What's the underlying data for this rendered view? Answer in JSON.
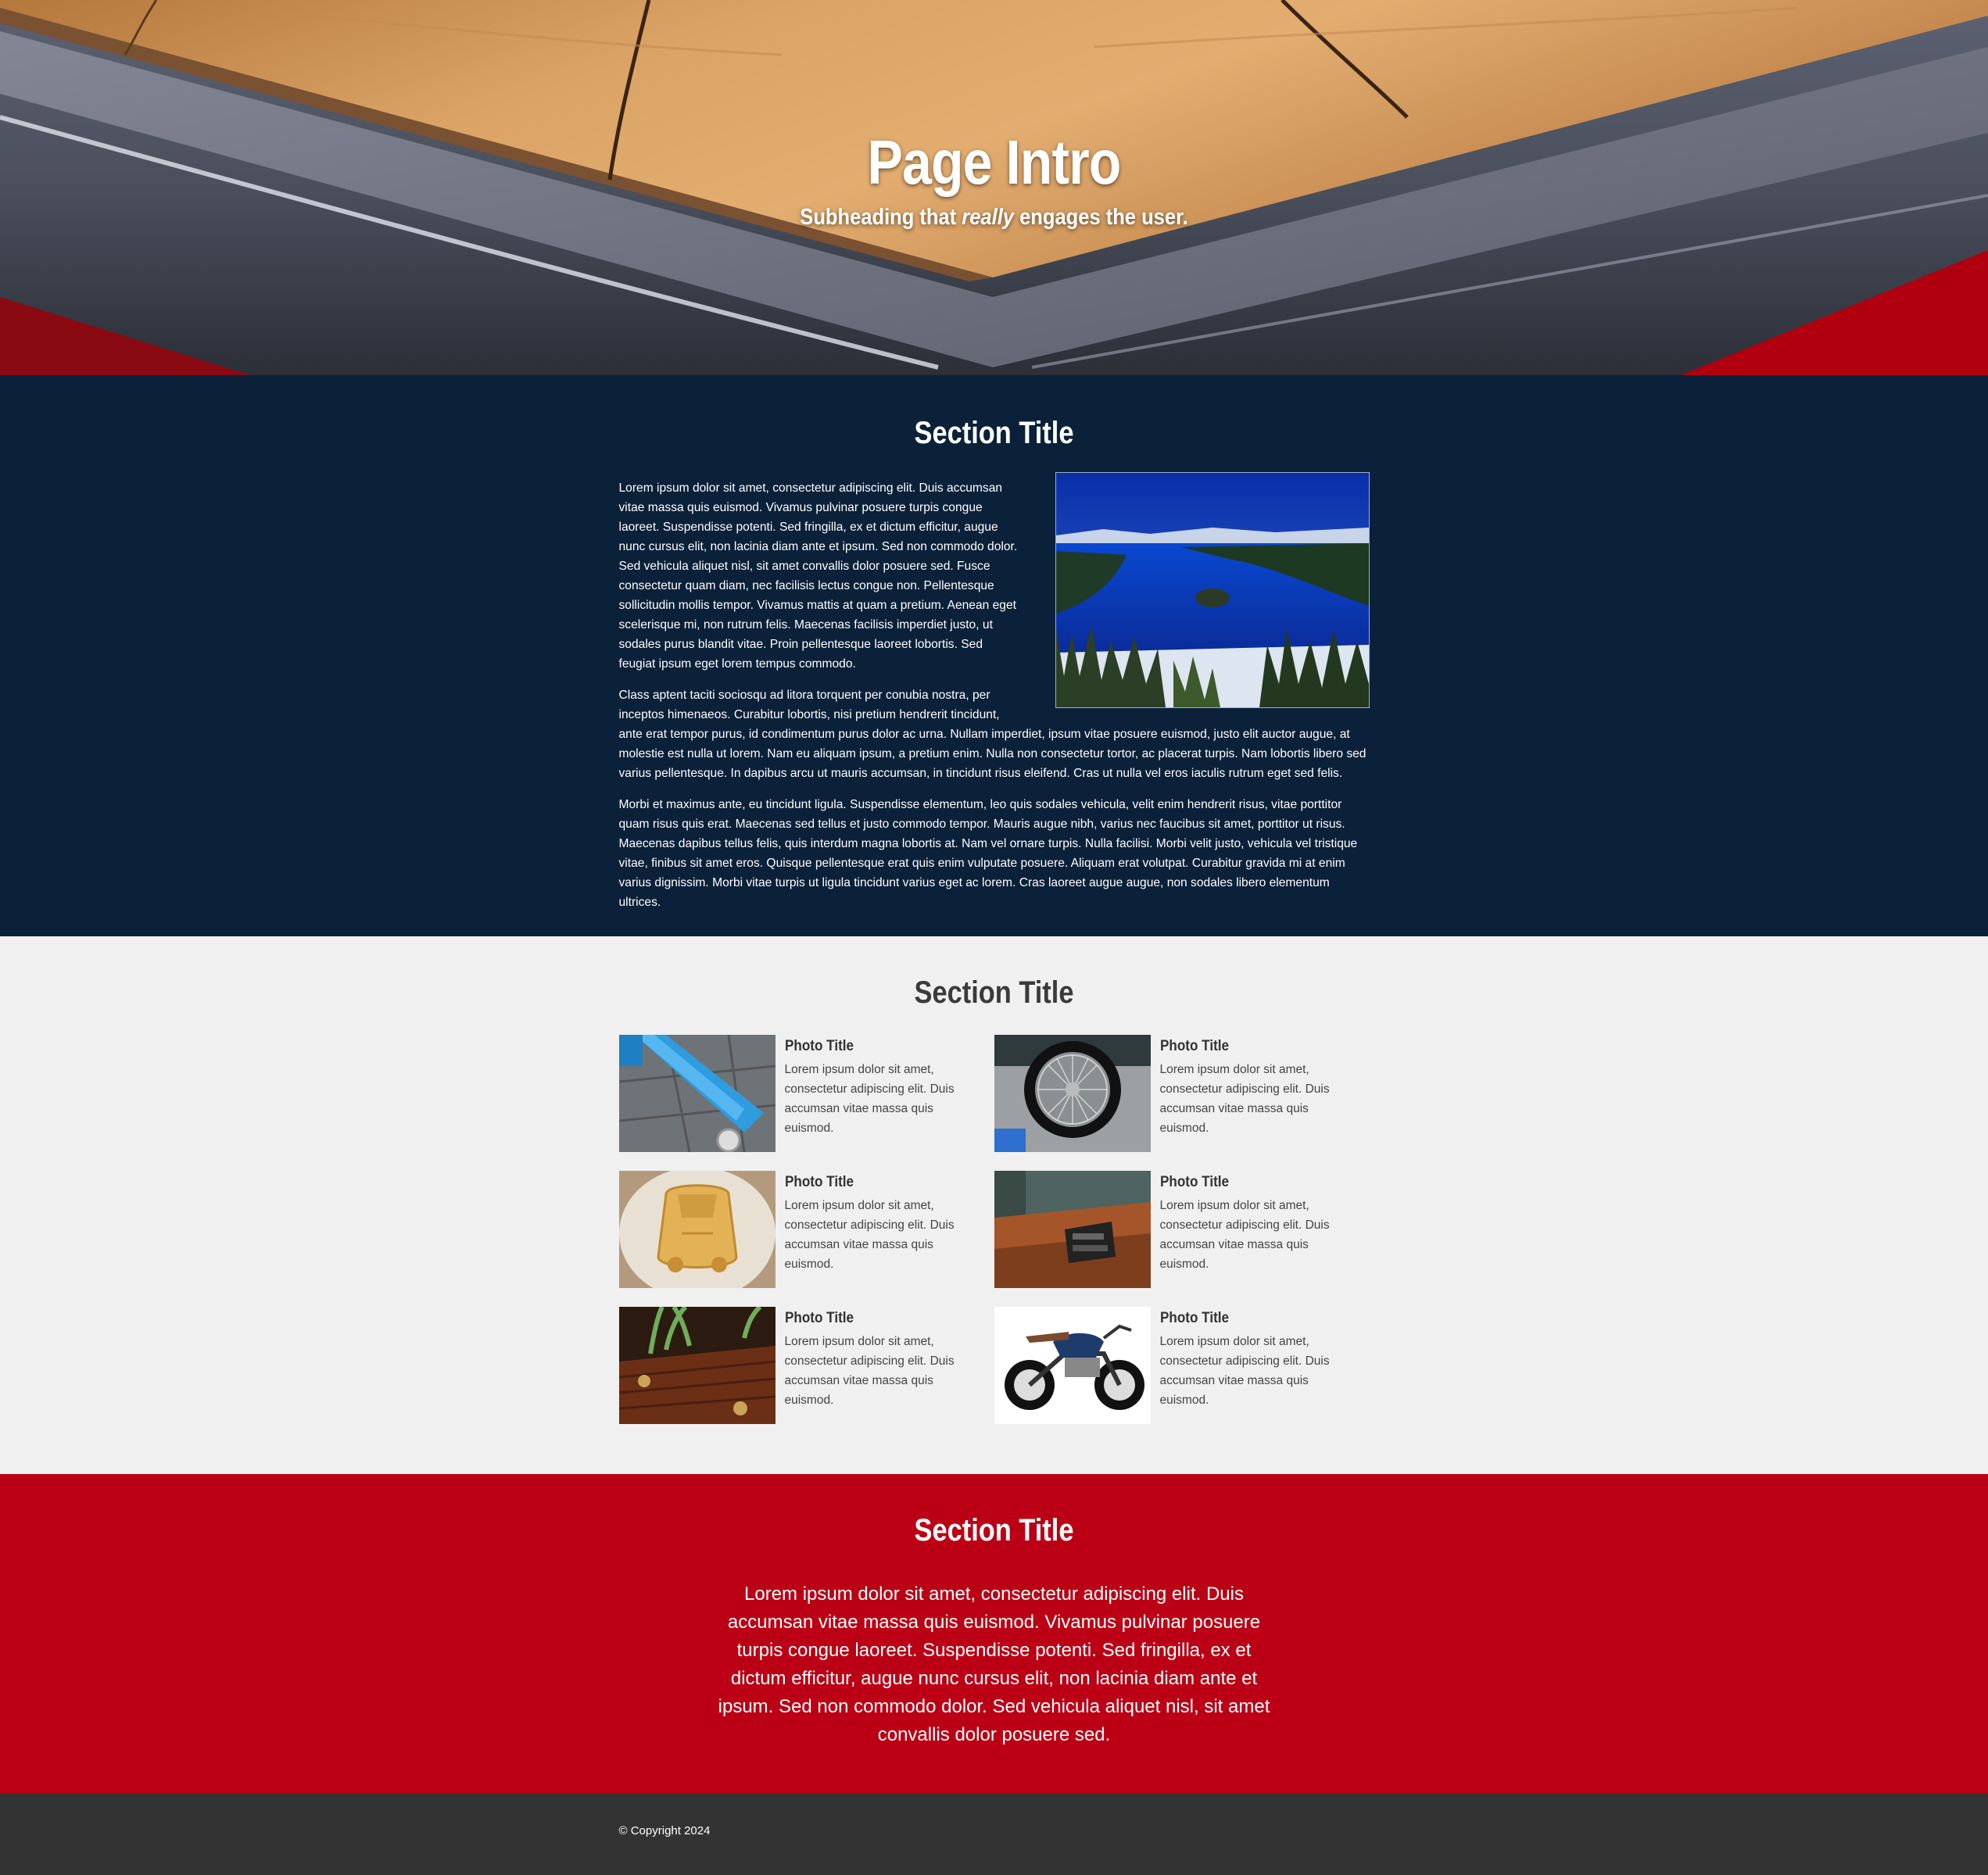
{
  "hero": {
    "title": "Page Intro",
    "subtitle_pre": "Subheading that ",
    "subtitle_em": "really",
    "subtitle_post": " engages the user."
  },
  "section1": {
    "title": "Section Title",
    "paragraphs": [
      "Lorem ipsum dolor sit amet, consectetur adipiscing elit. Duis accumsan vitae massa quis euismod. Vivamus pulvinar posuere turpis congue laoreet. Suspendisse potenti. Sed fringilla, ex et dictum efficitur, augue nunc cursus elit, non lacinia diam ante et ipsum. Sed non commodo dolor. Sed vehicula aliquet nisl, sit amet convallis dolor posuere sed. Fusce consectetur quam diam, nec facilisis lectus congue non. Pellentesque sollicitudin mollis tempor. Vivamus mattis at quam a pretium. Aenean eget scelerisque mi, non rutrum felis. Maecenas facilisis imperdiet justo, ut sodales purus blandit vitae. Proin pellentesque laoreet lobortis. Sed feugiat ipsum eget lorem tempus commodo.",
      "Class aptent taciti sociosqu ad litora torquent per conubia nostra, per inceptos himenaeos. Curabitur lobortis, nisi pretium hendrerit tincidunt, ante erat tempor purus, id condimentum purus dolor ac urna. Nullam imperdiet, ipsum vitae posuere euismod, justo elit auctor augue, at molestie est nulla ut lorem. Nam eu aliquam ipsum, a pretium enim. Nulla non consectetur tortor, ac placerat turpis. Nam lobortis libero sed varius pellentesque. In dapibus arcu ut mauris accumsan, in tincidunt risus eleifend. Cras ut nulla vel eros iaculis rutrum eget sed felis.",
      "Morbi et maximus ante, eu tincidunt ligula. Suspendisse elementum, leo quis sodales vehicula, velit enim hendrerit risus, vitae porttitor quam risus quis erat. Maecenas sed tellus et justo commodo tempor. Mauris augue nibh, varius nec faucibus sit amet, porttitor ut risus. Maecenas dapibus tellus felis, quis interdum magna lobortis at. Nam vel ornare turpis. Nulla facilisi. Morbi velit justo, vehicula vel tristique vitae, finibus sit amet eros. Quisque pellentesque erat quis enim vulputate posuere. Aliquam erat volutpat. Curabitur gravida mi at enim varius dignissim. Morbi vitae turpis ut ligula tincidunt varius eget ac lorem. Cras laoreet augue augue, non sodales libero elementum ultrices."
    ]
  },
  "section2": {
    "title": "Section Title",
    "photos": [
      {
        "title": "Photo Title",
        "desc": "Lorem ipsum dolor sit amet, consectetur adipiscing elit. Duis accumsan vitae massa quis euismod."
      },
      {
        "title": "Photo Title",
        "desc": "Lorem ipsum dolor sit amet, consectetur adipiscing elit. Duis accumsan vitae massa quis euismod."
      },
      {
        "title": "Photo Title",
        "desc": "Lorem ipsum dolor sit amet, consectetur adipiscing elit. Duis accumsan vitae massa quis euismod."
      },
      {
        "title": "Photo Title",
        "desc": "Lorem ipsum dolor sit amet, consectetur adipiscing elit. Duis accumsan vitae massa quis euismod."
      },
      {
        "title": "Photo Title",
        "desc": "Lorem ipsum dolor sit amet, consectetur adipiscing elit. Duis accumsan vitae massa quis euismod."
      },
      {
        "title": "Photo Title",
        "desc": "Lorem ipsum dolor sit amet, consectetur adipiscing elit. Duis accumsan vitae massa quis euismod."
      }
    ]
  },
  "section3": {
    "title": "Section Title",
    "text": "Lorem ipsum dolor sit amet, consectetur adipiscing elit. Duis accumsan vitae massa quis euismod. Vivamus pulvinar posuere turpis congue laoreet. Suspendisse potenti. Sed fringilla, ex et dictum efficitur, augue nunc cursus elit, non lacinia diam ante et ipsum. Sed non commodo dolor. Sed vehicula aliquet nisl, sit amet convallis dolor posuere sed."
  },
  "footer": {
    "copyright": "© Copyright 2024"
  },
  "colors": {
    "navy": "#0b2139",
    "light": "#f0f0f0",
    "red": "#bb0015",
    "footer": "#333333"
  }
}
